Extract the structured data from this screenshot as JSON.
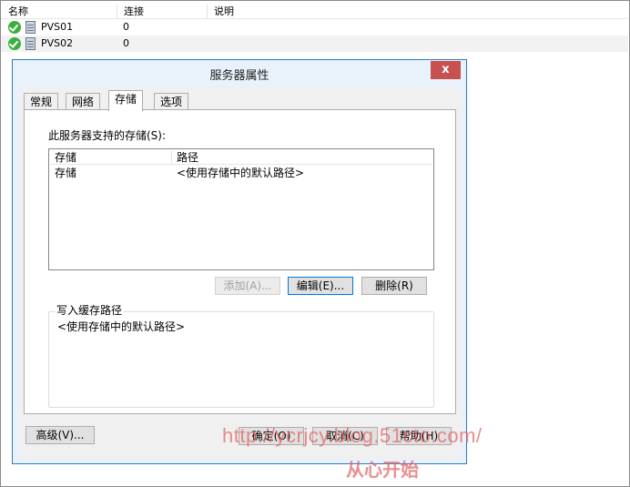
{
  "list": {
    "columns": [
      "名称",
      "连接",
      "说明"
    ],
    "rows": [
      {
        "name": "PVS01",
        "connections": "0",
        "description": ""
      },
      {
        "name": "PVS02",
        "connections": "0",
        "description": ""
      }
    ]
  },
  "dialog": {
    "title": "服务器属性",
    "close_label": "x",
    "tabs": [
      "常规",
      "网络",
      "存储",
      "选项"
    ],
    "active_tab": "存储",
    "storage_label": "此服务器支持的存储(S):",
    "storage_columns": [
      "存储",
      "路径"
    ],
    "storage_rows": [
      {
        "store": "存储",
        "path": "<使用存储中的默认路径>"
      }
    ],
    "add_button": "添加(A)...",
    "edit_button": "编辑(E)...",
    "delete_button": "删除(R)",
    "cache_label": "写入缓存路径",
    "cache_value": "<使用存储中的默认路径>",
    "advanced_button": "高级(V)...",
    "ok_button": "确定(O)",
    "cancel_button": "取消(C)",
    "help_button": "帮助(H)"
  },
  "watermark": {
    "url": "http://ycrjcy.blog.51cto.com/",
    "text": "从心开始"
  },
  "colors": {
    "dialog_border": "#2a7ac6",
    "close_button": "#c75050",
    "status_ok": "#3cae3c",
    "watermark": "#e26262"
  }
}
